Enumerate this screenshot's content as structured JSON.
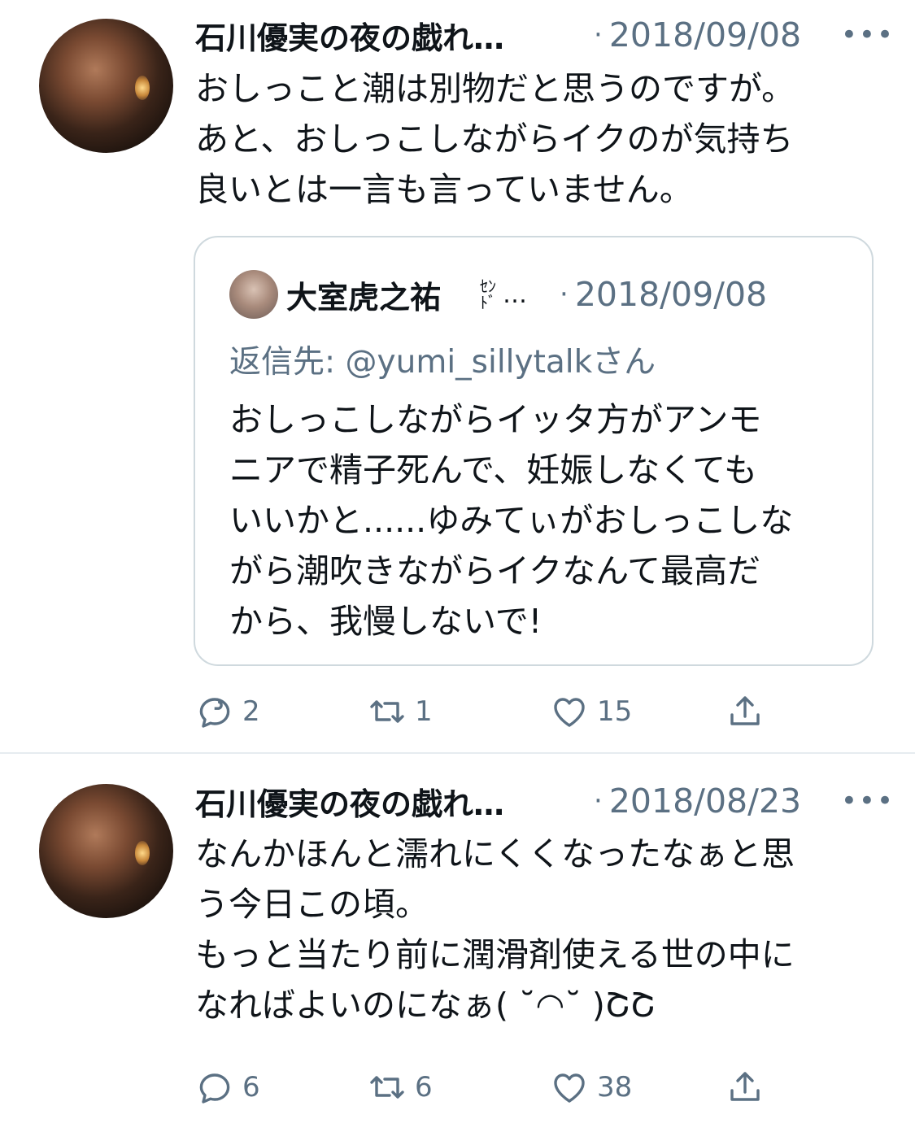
{
  "tweets": [
    {
      "author": "石川優実の夜の戯れ…",
      "separator": "·",
      "date": "2018/09/08",
      "more": "•••",
      "text": "おしっこと潮は別物だと思うのですが。\nあと、おしっこしながらイクのが気持ち\n良いとは一言も言っていません。",
      "quote": {
        "author": "大室虎之祐",
        "badge": "ｾﾝﾄﾞ",
        "ellipsis": "…",
        "separator": "·",
        "date": "2018/09/08",
        "reply_to": "返信先: @yumi_sillytalkさん",
        "text": "おしっこしながらイッタ方がアンモ\nニアで精子死んで、妊娠しなくても\nいいかと......ゆみてぃがおしっこしな\nがら潮吹きながらイクなんて最高だ\nから、我慢しないで!"
      },
      "replies": "2",
      "retweets": "1",
      "likes": "15"
    },
    {
      "author": "石川優実の夜の戯れ…",
      "separator": "·",
      "date": "2018/08/23",
      "more": "•••",
      "text": "なんかほんと濡れにくくなったなぁと思\nう今日この頃。\nもっと当たり前に潤滑剤使える世の中に\nなればよいのになぁ( ˘◠˘ )ՇՇ",
      "replies": "6",
      "retweets": "6",
      "likes": "38"
    }
  ],
  "icons": {
    "reply": "reply-icon",
    "retweet": "retweet-icon",
    "like": "heart-icon",
    "share": "share-icon"
  },
  "colors": {
    "secondary_text": "#5b7083",
    "border": "#cfd9de",
    "divider": "#e6ecf0"
  }
}
